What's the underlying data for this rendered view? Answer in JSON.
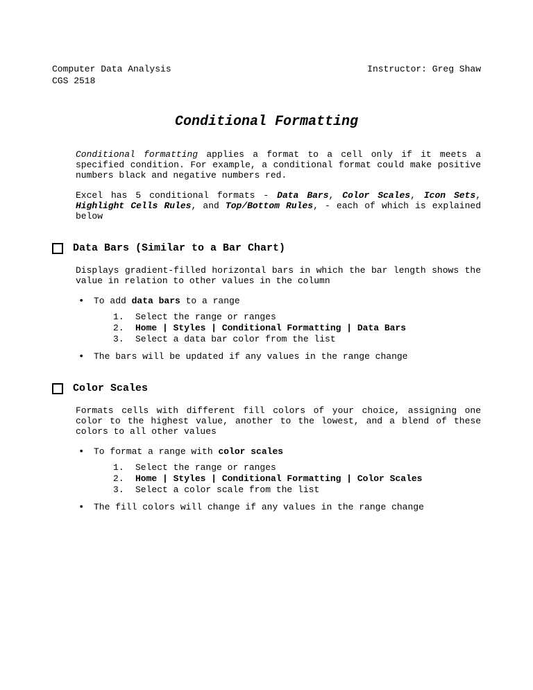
{
  "header": {
    "left": "Computer Data Analysis",
    "right": "Instructor: Greg Shaw",
    "course": "CGS 2518"
  },
  "title": "Conditional Formatting",
  "intro": {
    "lead_italic": "Conditional formatting",
    "lead_rest": " applies a format to a cell only if it meets a specified condition.  For example, a conditional format could make positive numbers black and negative numbers red."
  },
  "formats_para": {
    "pre": "Excel has 5 conditional formats - ",
    "f1": "Data Bars",
    "c1": ", ",
    "f2": "Color Scales",
    "c2": ", ",
    "f3": "Icon Sets",
    "c3": ", ",
    "f4": "Highlight Cells Rules",
    "c4": ", and ",
    "f5": "Top/Bottom Rules",
    "post": ", - each of which is explained below"
  },
  "sections": [
    {
      "heading": "Data Bars (Similar to a Bar Chart)",
      "desc": "Displays gradient-filled horizontal bars in which the bar length shows the value in relation to other values in the column",
      "todo_pre": "To add ",
      "todo_bold": "data bars",
      "todo_post": " to a range",
      "steps": [
        {
          "text": "Select the range or ranges",
          "bold": false
        },
        {
          "text": "Home | Styles | Conditional Formatting | Data Bars",
          "bold": true
        },
        {
          "text": "Select a data bar color from the list",
          "bold": false
        }
      ],
      "note": "The bars will be updated if any values in the range change"
    },
    {
      "heading": "Color Scales",
      "desc": "Formats cells with different fill colors of your choice, assigning one color to the highest value, another to the lowest, and a blend of these colors to all other values",
      "todo_pre": "To format a range with ",
      "todo_bold": "color scales",
      "todo_post": "",
      "steps": [
        {
          "text": "Select the range or ranges",
          "bold": false
        },
        {
          "text": "Home | Styles | Conditional Formatting | Color Scales",
          "bold": true
        },
        {
          "text": "Select a color scale from the list",
          "bold": false
        }
      ],
      "note": "The fill colors will change if any values in the range change"
    }
  ]
}
